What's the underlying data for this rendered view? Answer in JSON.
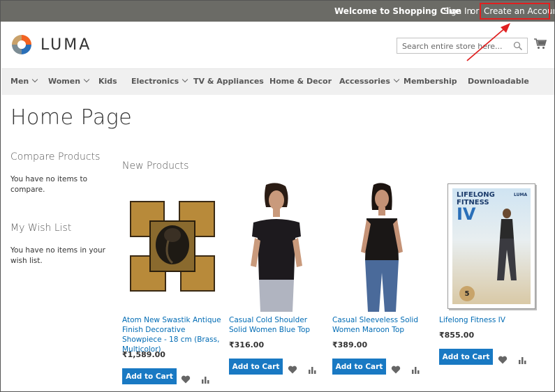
{
  "header": {
    "welcome": "Welcome to Shopping Clue",
    "sign_in": "Sign In",
    "or": "or",
    "create_account": "Create an Account",
    "logo_text": "LUMA",
    "search_placeholder": "Search entire store here..."
  },
  "nav": {
    "items": [
      {
        "label": "Men"
      },
      {
        "label": "Women"
      },
      {
        "label": "Kids"
      },
      {
        "label": "Electronics"
      },
      {
        "label": "TV & Appliances"
      },
      {
        "label": "Home & Decor"
      },
      {
        "label": "Accessories"
      },
      {
        "label": "Membership"
      },
      {
        "label": "Downloadable"
      }
    ]
  },
  "page": {
    "title": "Home Page"
  },
  "sidebar": {
    "compare_title": "Compare Products",
    "compare_text": "You have no items to compare.",
    "wishlist_title": "My Wish List",
    "wishlist_text": "You have no items in your wish list."
  },
  "products": {
    "section_title": "New Products",
    "add_to_cart_label": "Add to Cart",
    "items": [
      {
        "name": "Atom New Swastik Antique Finish Decorative Showpiece - 18 cm (Brass, Multicolor)",
        "price": "₹1,589.00"
      },
      {
        "name": "Casual Cold Shoulder Solid Women Blue Top",
        "price": "₹316.00"
      },
      {
        "name": "Casual Sleeveless Solid Women Maroon Top",
        "price": "₹389.00"
      },
      {
        "name": "Lifelong Fitness IV",
        "price": "₹855.00",
        "dvd_title_1": "LIFELONG",
        "dvd_title_2": "FITNESS",
        "dvd_title_3": "IV",
        "dvd_brand": "LUMA",
        "dvd_number": "5"
      }
    ]
  },
  "colors": {
    "panel": "#6b6b66",
    "link": "#006bb4",
    "button": "#1979c3",
    "highlight": "#e02020"
  }
}
